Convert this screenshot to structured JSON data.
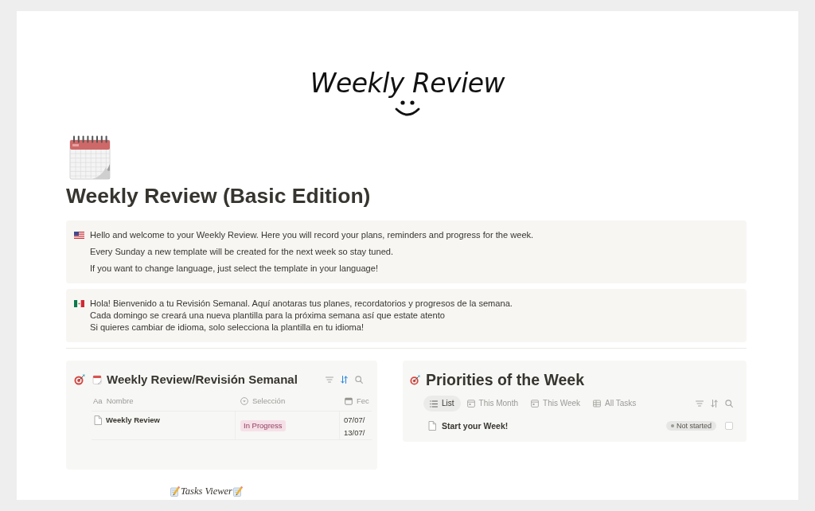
{
  "cover": {
    "title": "Weekly Review"
  },
  "page": {
    "title": "Weekly Review (Basic Edition)"
  },
  "callouts": [
    {
      "kind": "us",
      "paragraphs": [
        [
          "Hello and welcome to your Weekly Review. Here you will record your plans, reminders and progress for the week."
        ],
        [
          "Every Sunday a new template will be created for the next week so stay tuned."
        ],
        [
          "If you want to change language, just select the template in your language!"
        ]
      ]
    },
    {
      "kind": "mx",
      "paragraphs": [
        [
          "Hola! Bienvenido a tu Revisión Semanal. Aquí anotaras tus planes, recordatorios y progresos de la semana.",
          "Cada domingo se creará una nueva plantilla para la próxima semana así que estate atento",
          "Si quieres cambiar de idioma, solo selecciona la plantilla en tu idioma!"
        ]
      ]
    }
  ],
  "weekly_review_database": {
    "title": "Weekly Review/Revisión Semanal",
    "sort_active": true,
    "columns": [
      {
        "kind": "title",
        "glyph": "Aa",
        "label": "Nombre"
      },
      {
        "kind": "select",
        "label": "Selección"
      },
      {
        "kind": "date",
        "label": "Fec"
      }
    ],
    "rows": [
      {
        "name": "Weekly Review",
        "selection": "In Progress",
        "date_lines": [
          "07/07/",
          "13/07/"
        ]
      }
    ]
  },
  "priorities": {
    "title": "Priorities of the Week",
    "sort_active": false,
    "views": [
      {
        "kind": "list",
        "label": "List",
        "selected": true
      },
      {
        "kind": "calendar",
        "label": "This Month",
        "selected": false
      },
      {
        "kind": "calendar",
        "label": "This Week",
        "selected": false
      },
      {
        "kind": "table",
        "label": "All Tasks",
        "selected": false
      }
    ],
    "items": [
      {
        "title": "Start your Week!",
        "status": "Not started",
        "checked": false
      }
    ]
  },
  "tasks_viewer": {
    "heading": "Tasks Viewer"
  }
}
